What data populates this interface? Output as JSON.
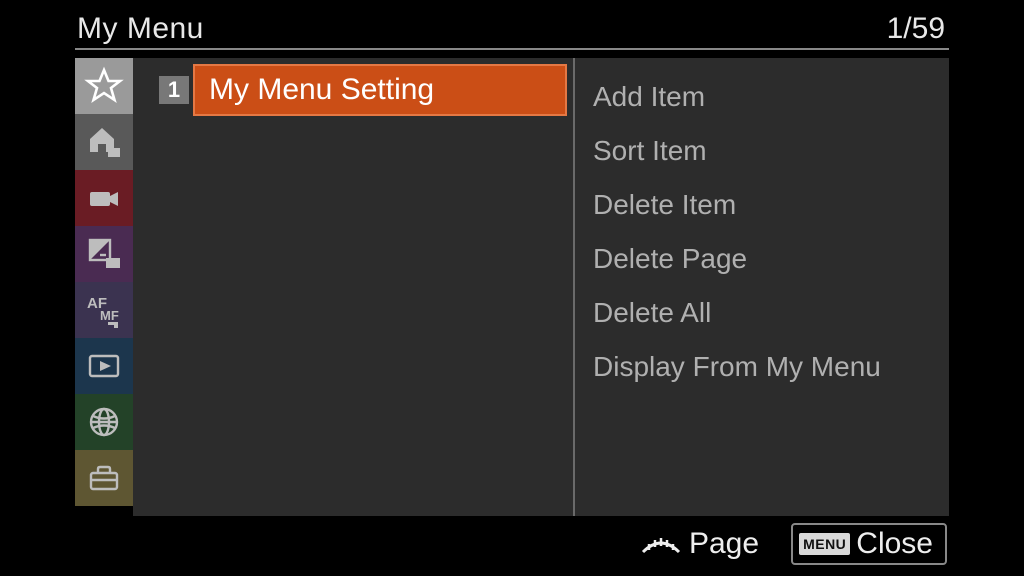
{
  "header": {
    "title": "My Menu",
    "page_indicator": "1/59"
  },
  "sidebar": {
    "tabs": [
      {
        "name": "star",
        "semantic": "my-menu"
      },
      {
        "name": "home",
        "semantic": "main"
      },
      {
        "name": "camera",
        "semantic": "shooting"
      },
      {
        "name": "exposure",
        "semantic": "exposure-color"
      },
      {
        "name": "afmf",
        "semantic": "focus"
      },
      {
        "name": "play",
        "semantic": "playback"
      },
      {
        "name": "globe",
        "semantic": "network"
      },
      {
        "name": "toolbox",
        "semantic": "setup"
      }
    ]
  },
  "main": {
    "page_number": "1",
    "selected_label": "My Menu Setting",
    "submenu": [
      "Add Item",
      "Sort Item",
      "Delete Item",
      "Delete Page",
      "Delete All",
      "Display From My Menu"
    ]
  },
  "footer": {
    "page_label": "Page",
    "menu_badge": "MENU",
    "close_label": "Close"
  }
}
